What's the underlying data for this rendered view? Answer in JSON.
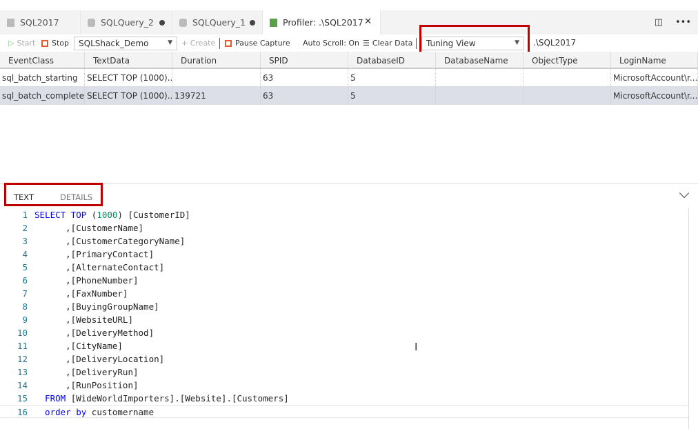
{
  "tabs": [
    {
      "label": "SQL2017",
      "icon": "file-icon"
    },
    {
      "label": "SQLQuery_2",
      "icon": "database-icon",
      "dirty": true
    },
    {
      "label": "SQLQuery_1",
      "icon": "database-icon",
      "dirty": true
    },
    {
      "label": "Profiler: .\\SQL2017",
      "icon": "profiler-grid-icon",
      "active": true
    }
  ],
  "toolbar": {
    "start": "Start",
    "stop": "Stop",
    "session": "SQLShack_Demo",
    "create": "+ Create",
    "pause": "Pause Capture",
    "autoscroll": "Auto Scroll: On",
    "clear": "Clear Data",
    "view": "Tuning View",
    "server": ".\\SQL2017"
  },
  "grid": {
    "columns": [
      "EventClass",
      "TextData",
      "Duration",
      "SPID",
      "DatabaseID",
      "DatabaseName",
      "ObjectType",
      "LoginName"
    ],
    "rows": [
      [
        "sql_batch_starting",
        "SELECT TOP (1000)...",
        "",
        "63",
        "5",
        "",
        "",
        "MicrosoftAccount\\r..."
      ],
      [
        "sql_batch_completed",
        "SELECT TOP (1000)...",
        "139721",
        "63",
        "5",
        "",
        "",
        "MicrosoftAccount\\r..."
      ]
    ]
  },
  "details": {
    "tabs": [
      "TEXT",
      "DETAILS"
    ]
  },
  "code": [
    [
      [
        "kw",
        "SELECT TOP "
      ],
      [
        "pl",
        "("
      ],
      [
        "nm",
        "1000"
      ],
      [
        "pl",
        ") [CustomerID]"
      ]
    ],
    [
      [
        "pl",
        "      ,[CustomerName]"
      ]
    ],
    [
      [
        "pl",
        "      ,[CustomerCategoryName]"
      ]
    ],
    [
      [
        "pl",
        "      ,[PrimaryContact]"
      ]
    ],
    [
      [
        "pl",
        "      ,[AlternateContact]"
      ]
    ],
    [
      [
        "pl",
        "      ,[PhoneNumber]"
      ]
    ],
    [
      [
        "pl",
        "      ,[FaxNumber]"
      ]
    ],
    [
      [
        "pl",
        "      ,[BuyingGroupName]"
      ]
    ],
    [
      [
        "pl",
        "      ,[WebsiteURL]"
      ]
    ],
    [
      [
        "pl",
        "      ,[DeliveryMethod]"
      ]
    ],
    [
      [
        "pl",
        "      ,[CityName]"
      ]
    ],
    [
      [
        "pl",
        "      ,[DeliveryLocation]"
      ]
    ],
    [
      [
        "pl",
        "      ,[DeliveryRun]"
      ]
    ],
    [
      [
        "pl",
        "      ,[RunPosition]"
      ]
    ],
    [
      [
        "kw",
        "  FROM "
      ],
      [
        "pl",
        "[WideWorldImporters].[Website].[Customers]"
      ]
    ],
    [
      [
        "kw",
        "  order by "
      ],
      [
        "pl",
        "customername"
      ]
    ]
  ]
}
